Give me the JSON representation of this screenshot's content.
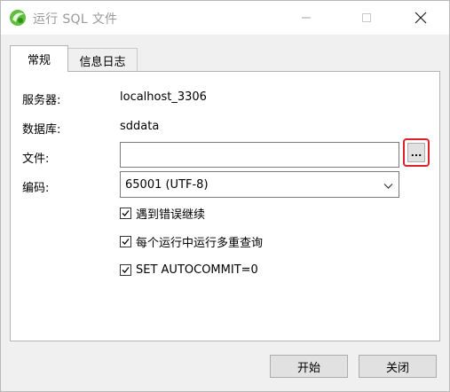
{
  "window": {
    "title": "运行 SQL 文件",
    "icon": "navicat-app-icon",
    "controls": {
      "minimize": "minimize-icon",
      "maximize": "maximize-icon",
      "close": "close-icon"
    }
  },
  "tabs": [
    {
      "label": "常规",
      "active": true
    },
    {
      "label": "信息日志",
      "active": false
    }
  ],
  "form": {
    "server_label": "服务器:",
    "server_value": "localhost_3306",
    "database_label": "数据库:",
    "database_value": "sddata",
    "file_label": "文件:",
    "file_value": "",
    "browse_label": "...",
    "encoding_label": "编码:",
    "encoding_value": "65001 (UTF-8)"
  },
  "options": [
    {
      "label": "遇到错误继续",
      "checked": true
    },
    {
      "label": "每个运行中运行多重查询",
      "checked": true
    },
    {
      "label": "SET AUTOCOMMIT=0",
      "checked": true
    }
  ],
  "buttons": {
    "start": "开始",
    "close": "关闭"
  },
  "colors": {
    "highlight": "#e0202b",
    "button_bg": "#e1e1e1",
    "panel_bg": "#ffffff",
    "window_bg": "#f0f0f0"
  }
}
